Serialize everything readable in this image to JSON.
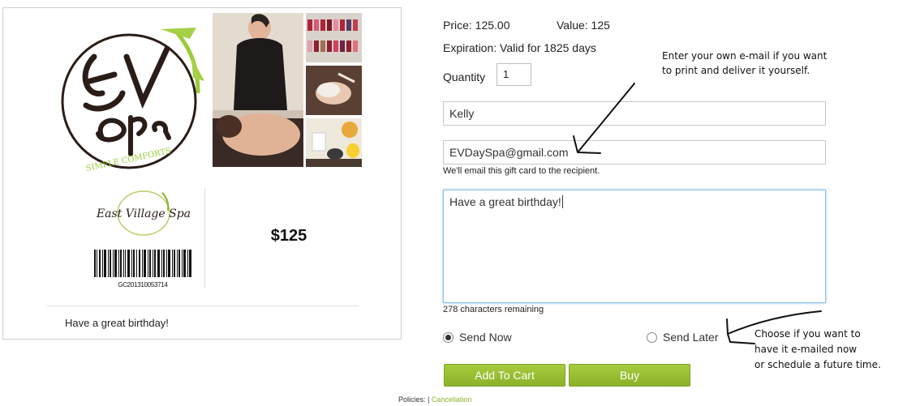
{
  "card": {
    "logo_ev_text": "EV Spa",
    "logo_ev_tagline": "SIMPLE COMFORTS",
    "logo_evs_text": "East Village Spa",
    "barcode_number": "GC201310053714",
    "amount": "$125",
    "message": "Have a great birthday!"
  },
  "details": {
    "price_label": "Price:  125.00",
    "value_label": "Value: 125",
    "expiration": "Expiration: Valid for 1825 days",
    "quantity_label": "Quantity",
    "quantity_value": "1"
  },
  "form": {
    "name_value": "Kelly",
    "email_value": "EVDaySpa@gmail.com",
    "email_hint": "We'll email this gift card to the recipient.",
    "message_value": "Have a great birthday!",
    "chars_remaining": "278 characters remaining",
    "send_now_label": "Send Now",
    "send_later_label": "Send Later",
    "send_now_selected": true,
    "add_to_cart_label": "Add To Cart",
    "buy_label": "Buy"
  },
  "footer": {
    "policies_label": "Policies:",
    "separator": "|",
    "cancellation_link": "Cancellation"
  },
  "annotations": {
    "email_note": "Enter your own e-mail if you want\nto print and deliver it yourself.",
    "send_note": "Choose if you want to\nhave it e-mailed now\nor schedule a future time."
  },
  "colors": {
    "accent_green": "#8cb22a",
    "focus_blue": "#8fc1e6"
  }
}
